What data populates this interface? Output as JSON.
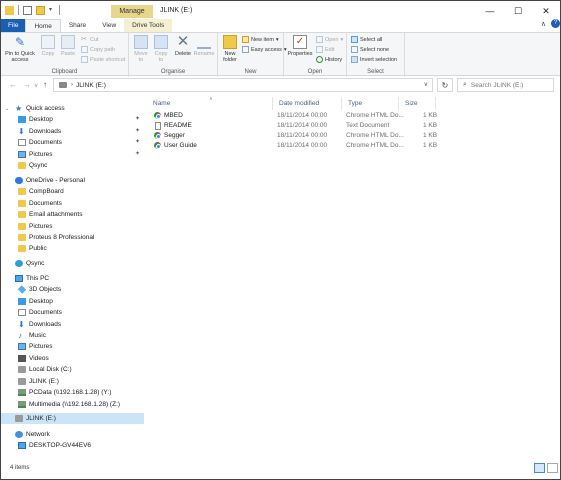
{
  "window": {
    "title": "JLINK (E:)",
    "contextual_tab": "Manage",
    "controls": {
      "minimize": "—",
      "maximize": "☐",
      "close": "✕"
    }
  },
  "ribbon_tabs": [
    "File",
    "Home",
    "Share",
    "View",
    "Drive Tools"
  ],
  "ribbon": {
    "clipboard": {
      "label": "Clipboard",
      "pin_to_quick_access": "Pin to Quick access",
      "copy": "Copy",
      "paste": "Paste",
      "cut": "Cut",
      "copy_path": "Copy path",
      "paste_shortcut": "Paste shortcut"
    },
    "organise": {
      "label": "Organise",
      "move_to": "Move to",
      "copy_to": "Copy to",
      "delete": "Delete",
      "rename": "Rename"
    },
    "new": {
      "label": "New",
      "new_folder": "New folder",
      "new_item": "New item",
      "easy_access": "Easy access"
    },
    "open": {
      "label": "Open",
      "properties": "Properties",
      "open": "Open",
      "edit": "Edit",
      "history": "History"
    },
    "select": {
      "label": "Select",
      "select_all": "Select all",
      "select_none": "Select none",
      "invert_selection": "Invert selection"
    }
  },
  "address": {
    "path": "JLINK (E:)",
    "search_placeholder": "Search JLINK (E:)"
  },
  "nav": {
    "quick_access": {
      "label": "Quick access",
      "items": [
        "Desktop",
        "Downloads",
        "Documents",
        "Pictures",
        "Qsync"
      ]
    },
    "onedrive": {
      "label": "OneDrive - Personal",
      "items": [
        "CompBoard",
        "Documents",
        "Email attachments",
        "Pictures",
        "Proteus 8 Professional",
        "Public"
      ]
    },
    "qsync": "Qsync",
    "this_pc": {
      "label": "This PC",
      "items": [
        "3D Objects",
        "Desktop",
        "Documents",
        "Downloads",
        "Music",
        "Pictures",
        "Videos",
        "Local Disk (C:)",
        "JLINK (E:)",
        "PCData (\\\\192.168.1.28) (Y:)",
        "Multimedia (\\\\192.168.1.28) (Z:)"
      ]
    },
    "jlink_drive": "JLINK (E:)",
    "network": {
      "label": "Network",
      "items": [
        "DESKTOP-GV44EV6"
      ]
    }
  },
  "columns": [
    "Name",
    "Date modified",
    "Type",
    "Size"
  ],
  "files": [
    {
      "name": "MBED",
      "date": "18/11/2014 00:00",
      "type": "Chrome HTML Do...",
      "size": "1 KB",
      "icon": "chrome-icon"
    },
    {
      "name": "README",
      "date": "18/11/2014 00:00",
      "type": "Text Document",
      "size": "1 KB",
      "icon": "text-file-icon"
    },
    {
      "name": "Segger",
      "date": "18/11/2014 00:00",
      "type": "Chrome HTML Do...",
      "size": "1 KB",
      "icon": "chrome-icon"
    },
    {
      "name": "User Guide",
      "date": "18/11/2014 00:00",
      "type": "Chrome HTML Do...",
      "size": "1 KB",
      "icon": "chrome-icon"
    }
  ],
  "status": {
    "item_count": "4 items"
  },
  "colors": {
    "file_tab": "#1a5fb4",
    "manage_tab": "#e8d68a",
    "selection": "#cce4f7"
  }
}
